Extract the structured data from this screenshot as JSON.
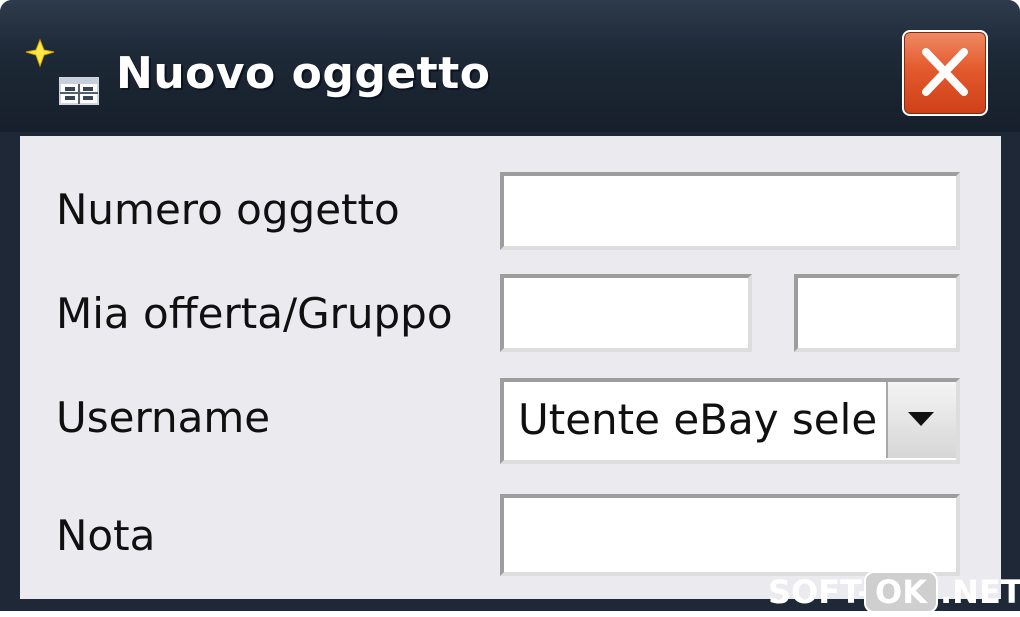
{
  "window": {
    "title": "Nuovo oggetto",
    "icon": "new-item-icon",
    "close_icon": "close-icon",
    "close_color": "#e35a2e"
  },
  "form": {
    "item_number": {
      "label": "Numero oggetto",
      "value": ""
    },
    "bid_group": {
      "label": "Mia offerta/Gruppo",
      "bid_value": "",
      "group_value": ""
    },
    "username": {
      "label": "Username",
      "selected": "Utente eBay sele",
      "arrow_icon": "dropdown-arrow-icon"
    },
    "note": {
      "label": "Nota",
      "value": ""
    }
  },
  "watermark": {
    "left": "SOFT-",
    "middle": "OK",
    "right": ".NET"
  }
}
